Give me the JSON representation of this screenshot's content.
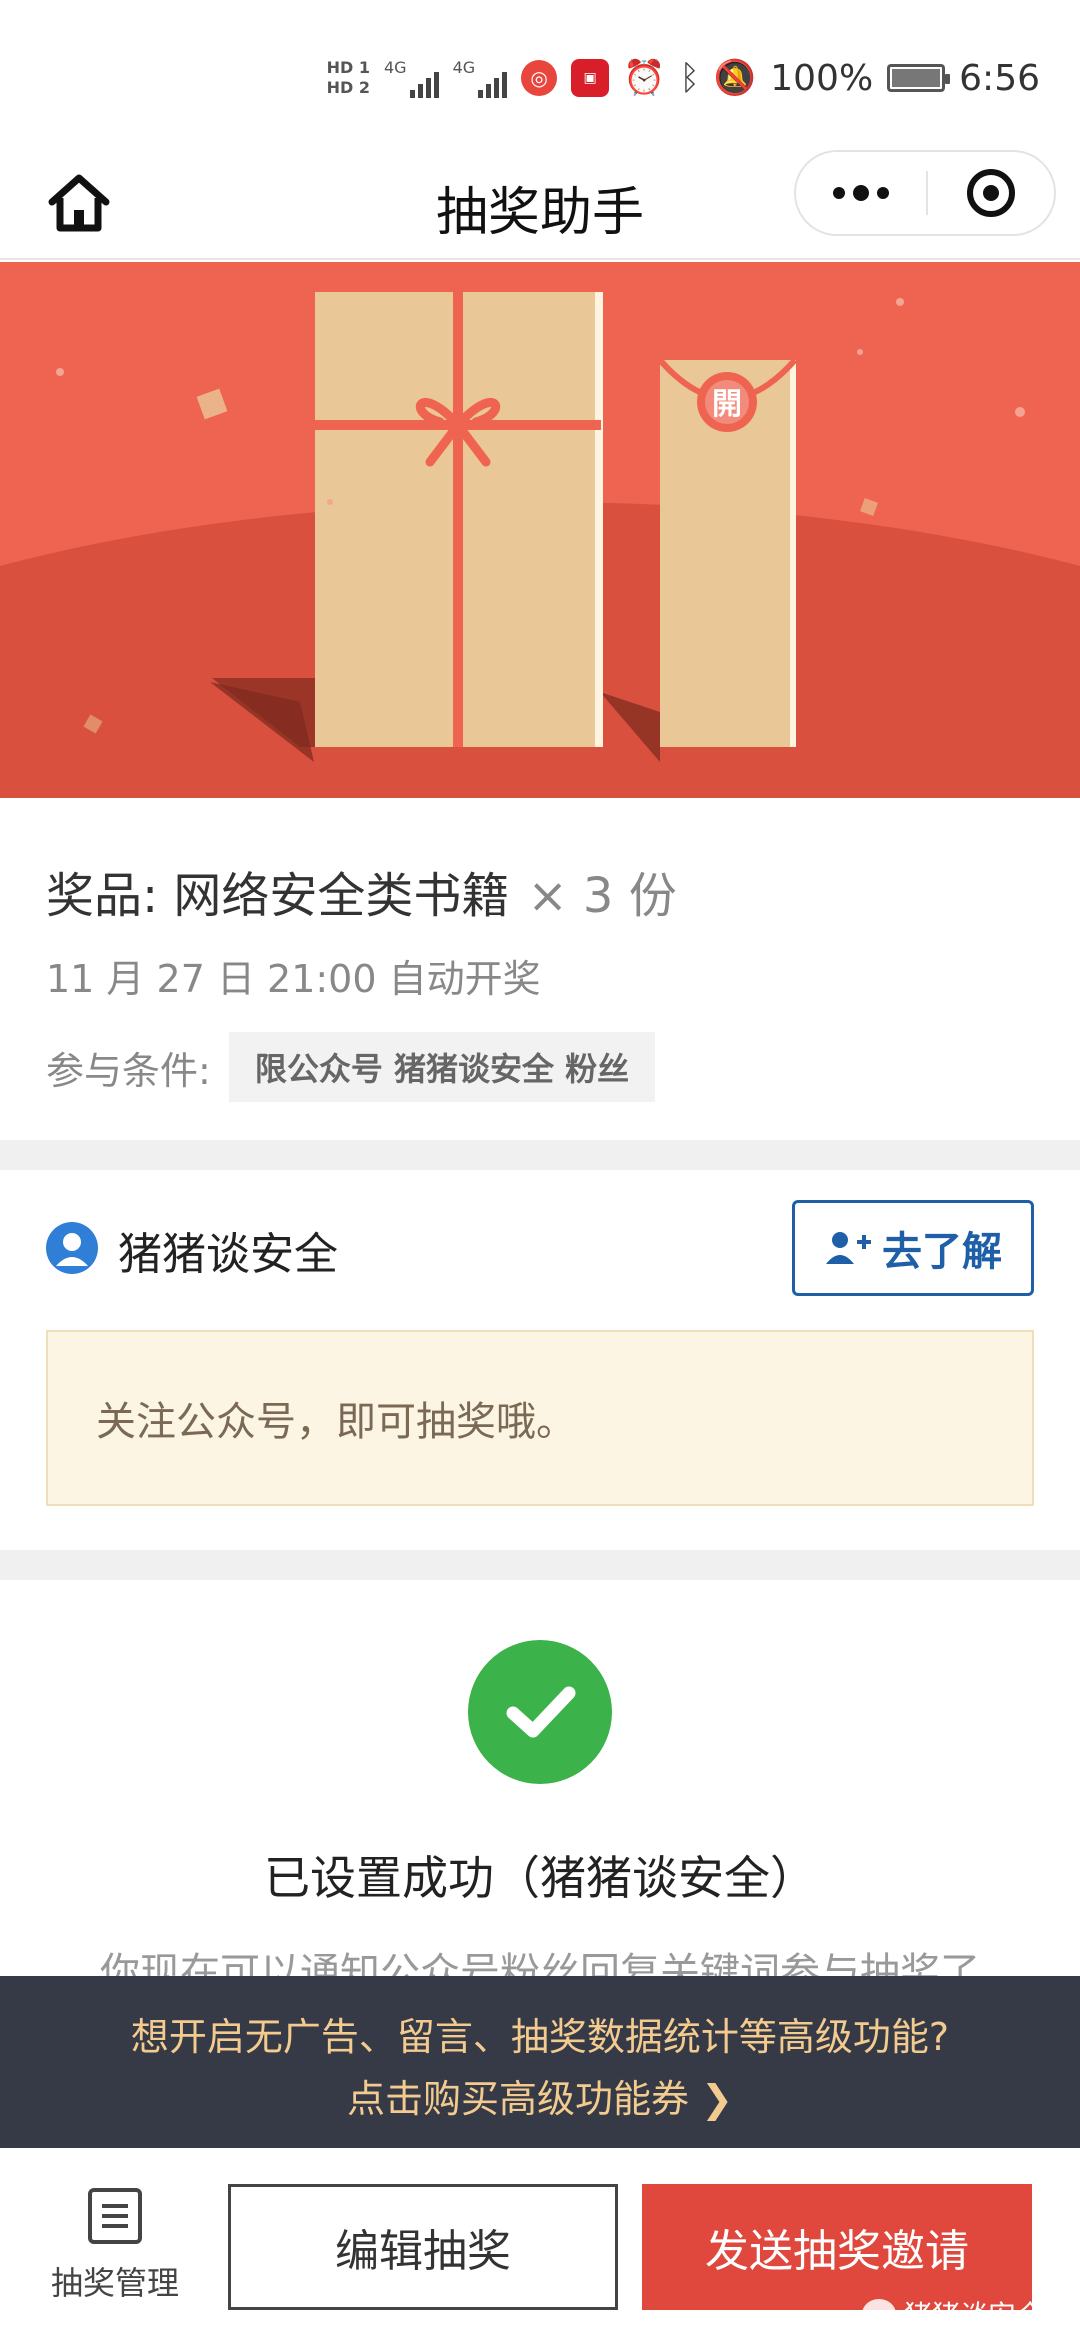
{
  "status_bar": {
    "hd1": "HD 1",
    "hd2": "HD 2",
    "sig1": "4G",
    "sig2": "4G",
    "battery_level": "100%",
    "battery_percent": 100,
    "time": "6:56",
    "icons": [
      "alarm-icon",
      "bluetooth-icon",
      "mute-bell-icon"
    ]
  },
  "nav": {
    "title": "抽奖助手"
  },
  "banner": {
    "open_seal": "開"
  },
  "prize": {
    "label": "奖品: 网络安全类书籍",
    "multiplier": "× 3 份",
    "draw_time": "11 月 27 日 21:00 自动开奖",
    "condition_label": "参与条件:",
    "condition_tag": "限公众号 猪猪谈安全 粉丝"
  },
  "account": {
    "name": "猪猪谈安全",
    "learn_button": "去了解",
    "notice": "关注公众号，即可抽奖哦。"
  },
  "success": {
    "message": "已设置成功（猪猪谈安全）",
    "hidden_text": "你现在可以通知公众号粉丝回复关键词参与抽奖了"
  },
  "promo": {
    "line1": "想开启无广告、留言、抽奖数据统计等高级功能?",
    "line2": "点击购买高级功能券 ❯"
  },
  "bottom": {
    "manage_label": "抽奖管理",
    "edit_button": "编辑抽奖",
    "send_button": "发送抽奖邀请",
    "watermark": "猪猪谈安全"
  },
  "colors": {
    "banner": "#ef6450",
    "accent_blue": "#1e5fa8",
    "success_green": "#3bb34a",
    "send_red": "#e0473d",
    "promo_bg": "#363a47",
    "promo_text": "#f3cb8f"
  }
}
